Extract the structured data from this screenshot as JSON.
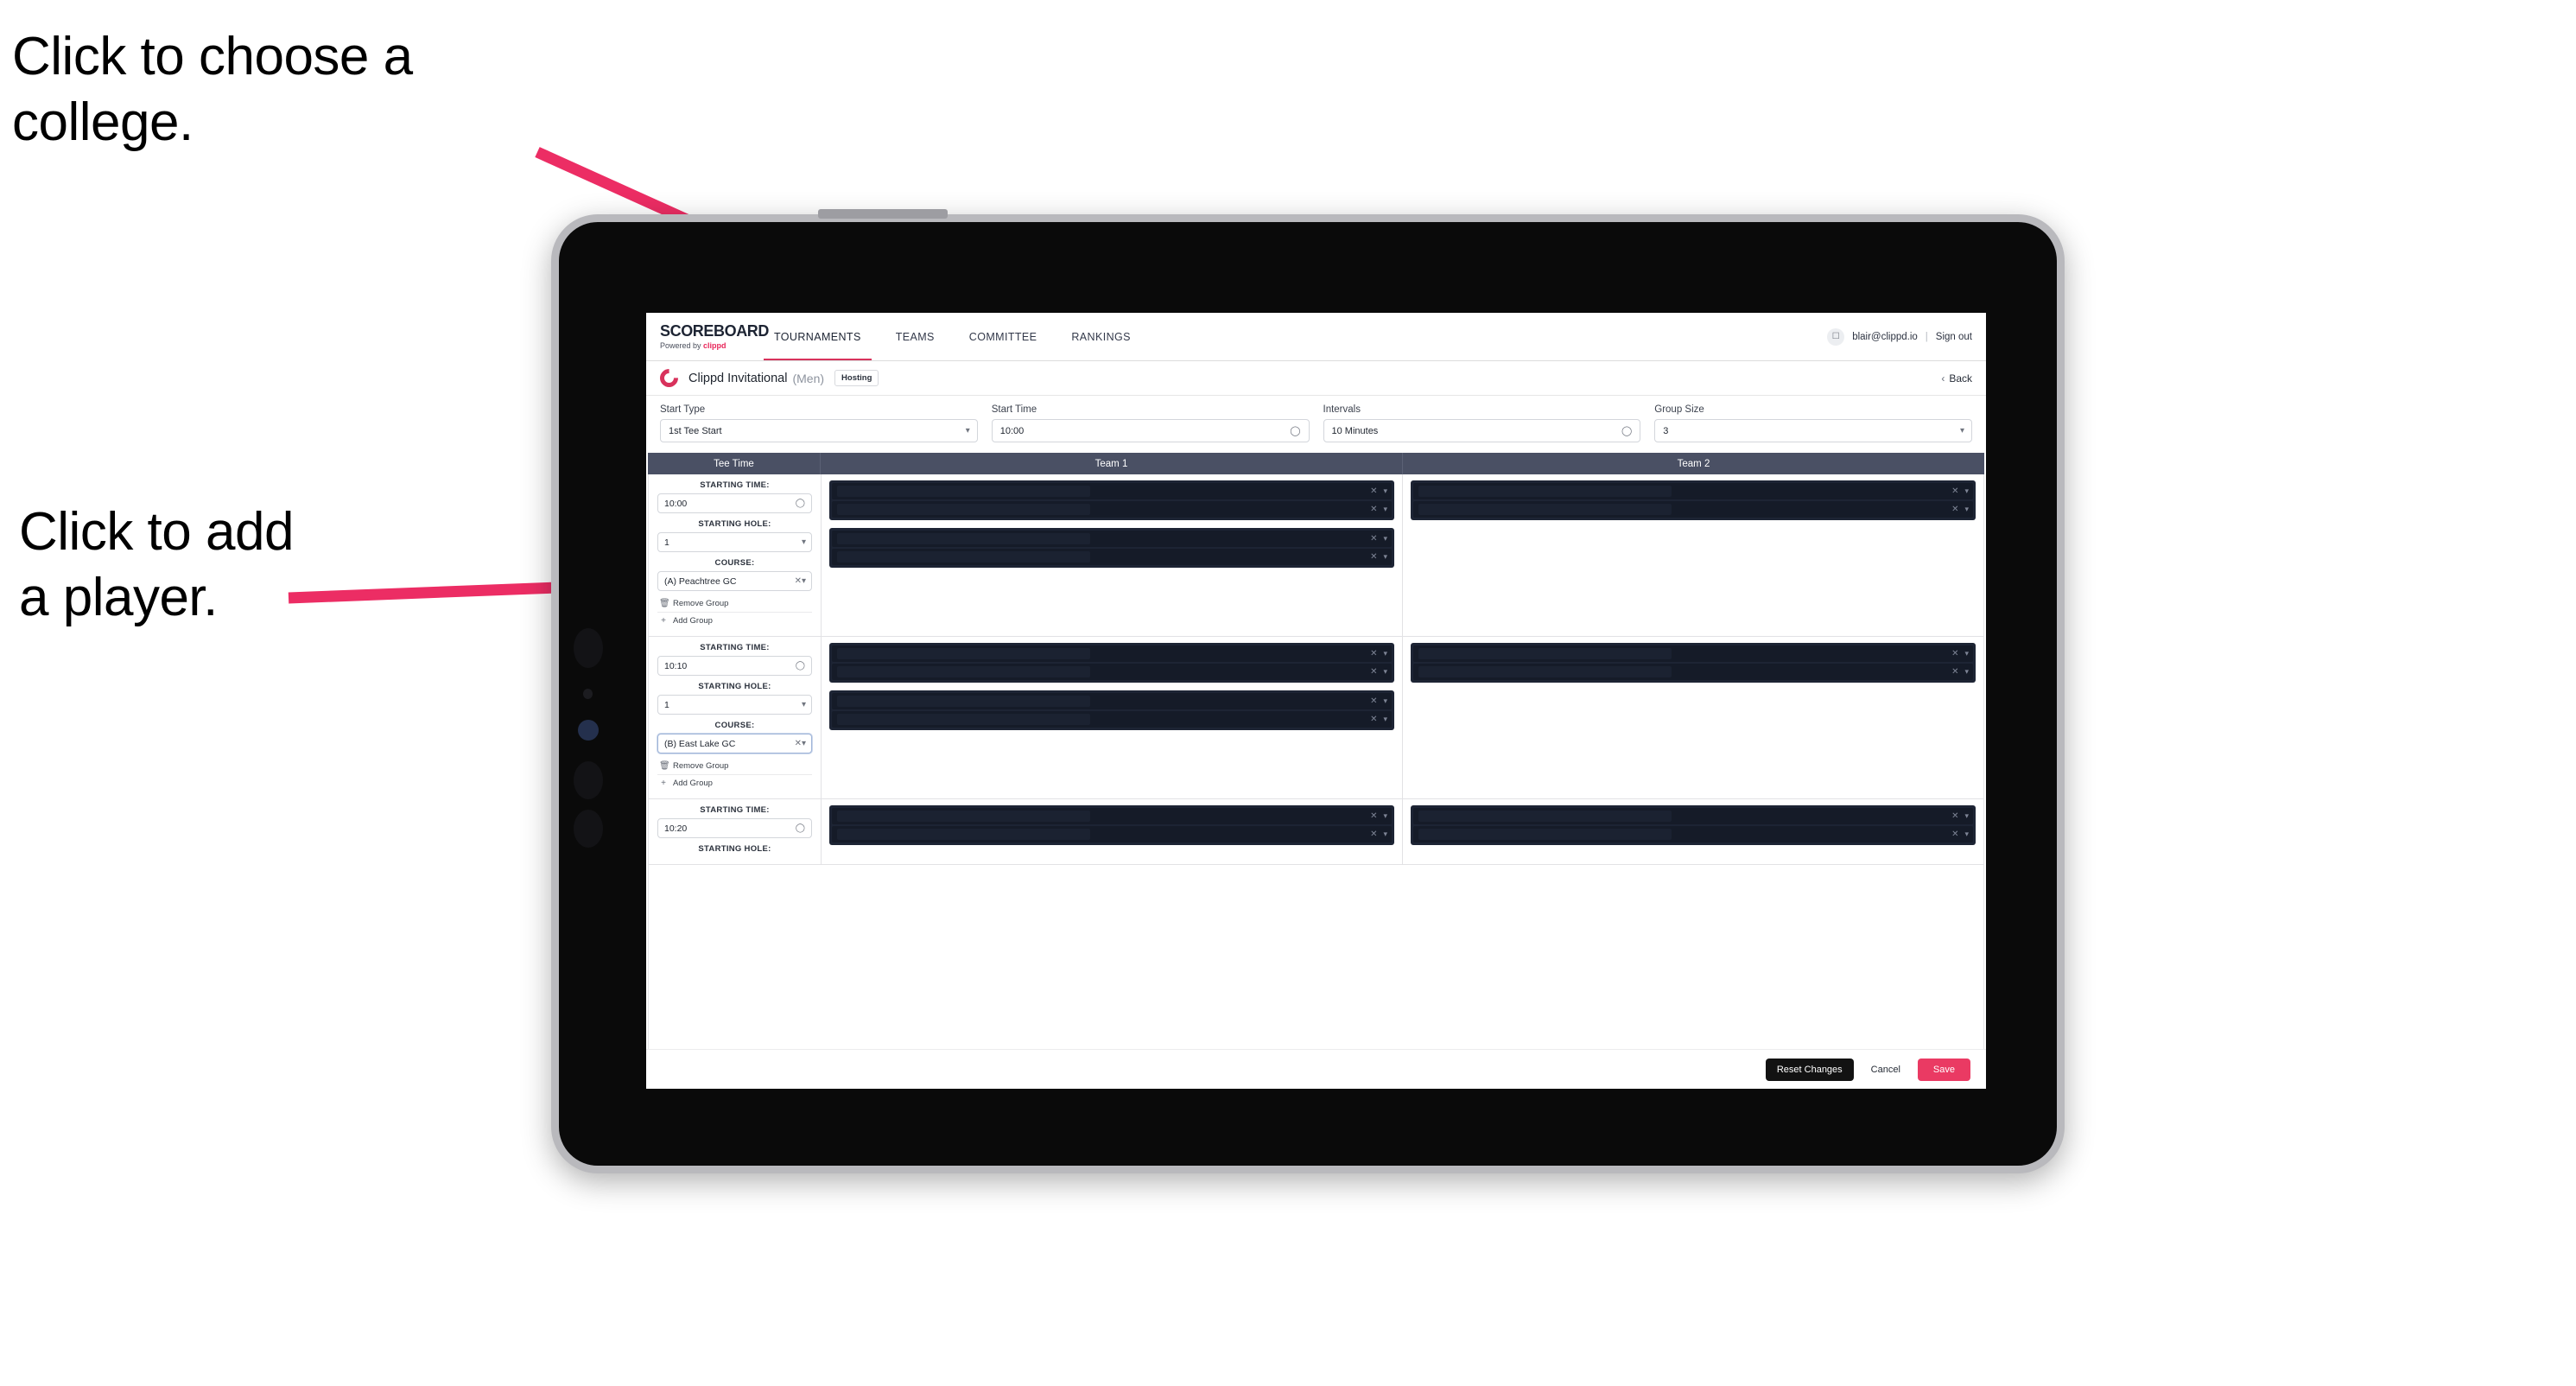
{
  "annotations": {
    "college": "Click to choose a\ncollege.",
    "player": "Click to add\na player."
  },
  "colors": {
    "accent_pink": "#d8325c",
    "save_pink": "#ea3a63",
    "header_slate": "#4a5064",
    "slot_dark": "#1d2434"
  },
  "topnav": {
    "brand_title": "SCOREBOARD",
    "brand_sub_prefix": "Powered by ",
    "brand_sub_name": "clippd",
    "tabs": [
      {
        "label": "TOURNAMENTS",
        "active": true
      },
      {
        "label": "TEAMS",
        "active": false
      },
      {
        "label": "COMMITTEE",
        "active": false
      },
      {
        "label": "RANKINGS",
        "active": false
      }
    ],
    "avatar_icon": "user-avatar-icon",
    "email": "blair@clippd.io",
    "separator": "|",
    "sign_out": "Sign out"
  },
  "tournament_bar": {
    "logo_icon": "clippd-c-logo-icon",
    "title": "Clippd Invitational",
    "gender": "(Men)",
    "status_badge": "Hosting",
    "back_chevron": "‹",
    "back_label": "Back"
  },
  "form": {
    "fields": [
      {
        "label": "Start Type",
        "value": "1st Tee Start",
        "icon": "updown-stepper-icon"
      },
      {
        "label": "Start Time",
        "value": "10:00",
        "icon": "clock-icon"
      },
      {
        "label": "Intervals",
        "value": "10 Minutes",
        "icon": "clock-icon"
      },
      {
        "label": "Group Size",
        "value": "3",
        "icon": "updown-stepper-icon"
      }
    ]
  },
  "table": {
    "headers": {
      "tee_time": "Tee Time",
      "team1": "Team 1",
      "team2": "Team 2"
    },
    "labels": {
      "starting_time": "STARTING TIME:",
      "starting_hole": "STARTING HOLE:",
      "course": "COURSE:",
      "remove_group": "Remove Group",
      "add_group": "Add Group"
    },
    "icons": {
      "clock": "clock-icon",
      "clear": "clear-x-icon",
      "stepper": "updown-stepper-icon",
      "trash": "trash-icon",
      "plus": "plus-icon"
    },
    "groups": [
      {
        "starting_time": "10:00",
        "starting_hole": "1",
        "course": "(A) Peachtree GC",
        "course_focused": false,
        "team1_blocks": [
          2,
          2
        ],
        "team2_blocks": [
          2
        ]
      },
      {
        "starting_time": "10:10",
        "starting_hole": "1",
        "course": "(B) East Lake GC",
        "course_focused": true,
        "team1_blocks": [
          2,
          2
        ],
        "team2_blocks": [
          2
        ]
      },
      {
        "starting_time": "10:20",
        "starting_hole": "",
        "course": "",
        "course_focused": false,
        "team1_blocks": [
          2
        ],
        "team2_blocks": [
          2
        ]
      }
    ]
  },
  "footer": {
    "reset_label": "Reset Changes",
    "cancel_label": "Cancel",
    "save_label": "Save"
  }
}
